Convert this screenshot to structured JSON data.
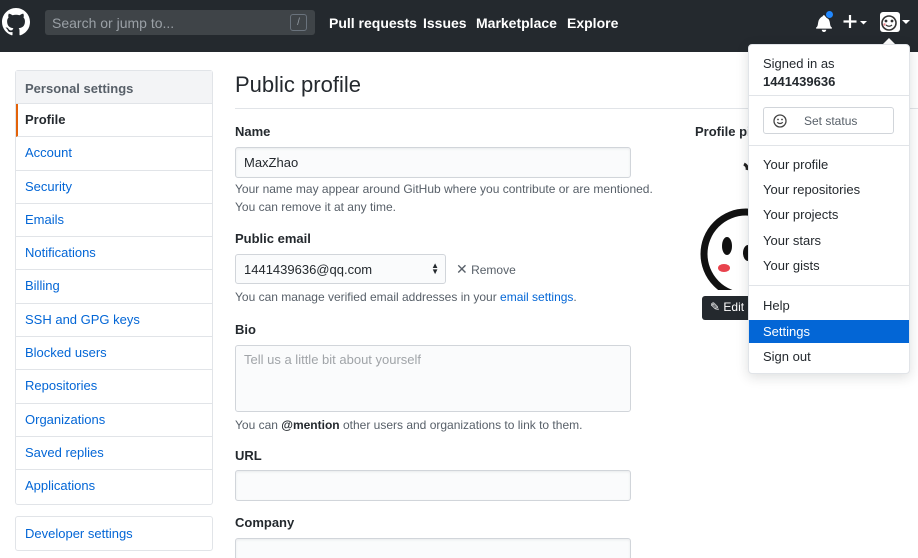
{
  "header": {
    "search_placeholder": "Search or jump to...",
    "search_shortcut": "/",
    "nav": [
      "Pull requests",
      "Issues",
      "Marketplace",
      "Explore"
    ],
    "notification_color": "#2188ff"
  },
  "sidebar": {
    "heading": "Personal settings",
    "items": [
      "Profile",
      "Account",
      "Security",
      "Emails",
      "Notifications",
      "Billing",
      "SSH and GPG keys",
      "Blocked users",
      "Repositories",
      "Organizations",
      "Saved replies",
      "Applications"
    ],
    "selected": "Profile",
    "developer_settings": "Developer settings"
  },
  "main": {
    "title": "Public profile",
    "name_label": "Name",
    "name_value": "MaxZhao",
    "name_note_1": "Your name may appear around GitHub where you contribute or are mentioned.",
    "name_note_2": "You can remove it at any time.",
    "email_label": "Public email",
    "email_value": "1441439636@qq.com",
    "remove_label": "Remove",
    "email_note_prefix": "You can manage verified email addresses in your ",
    "email_note_link": "email settings",
    "email_note_suffix": ".",
    "bio_label": "Bio",
    "bio_placeholder": "Tell us a little bit about yourself",
    "bio_note_prefix": "You can ",
    "bio_note_mention": "@mention",
    "bio_note_suffix": " other users and organizations to link to them.",
    "url_label": "URL",
    "url_value": "",
    "company_label": "Company",
    "picture_label": "Profile picture",
    "edit_label": "Edit"
  },
  "dropdown": {
    "signed_in_as": "Signed in as",
    "username": "1441439636",
    "set_status": "Set status",
    "items_group1": [
      "Your profile",
      "Your repositories",
      "Your projects",
      "Your stars",
      "Your gists"
    ],
    "items_group2": [
      "Help",
      "Settings",
      "Sign out"
    ],
    "active": "Settings"
  },
  "colors": {
    "header_bg": "#24292e",
    "link": "#0366d6",
    "selected_accent": "#e36209"
  }
}
